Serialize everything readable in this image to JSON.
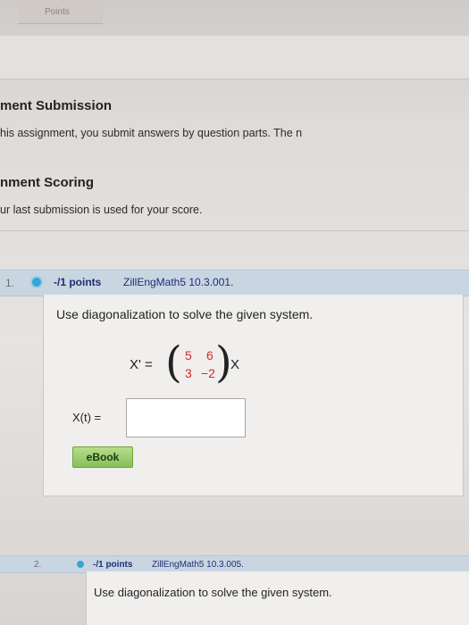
{
  "header": {
    "tab_label": "Points"
  },
  "submission": {
    "title": "ment Submission",
    "text": "his assignment, you submit answers by question parts. The n"
  },
  "scoring": {
    "title": "nment Scoring",
    "text": "ur last submission is used for your score."
  },
  "question1": {
    "number": "1.",
    "points_label": "-/1 points",
    "code": "ZillEngMath5 10.3.001.",
    "prompt": "Use diagonalization to solve the given system.",
    "equation_lhs": "X' =",
    "matrix": [
      "5",
      "6",
      "3",
      "−2"
    ],
    "equation_rhs": "X",
    "answer_label": "X(t) =",
    "answer_value": "",
    "ebook_label": "eBook"
  },
  "question2": {
    "number": "2.",
    "points_label": "-/1 points",
    "code": "ZillEngMath5 10.3.005.",
    "prompt": "Use diagonalization to solve the given system."
  },
  "colors": {
    "header_bar": "#c9d6e2",
    "points_text": "#1f2c76",
    "matrix_entries": "#d22a2a",
    "ebook_button": "#8fc763",
    "bullet": "#2fa7d8"
  }
}
